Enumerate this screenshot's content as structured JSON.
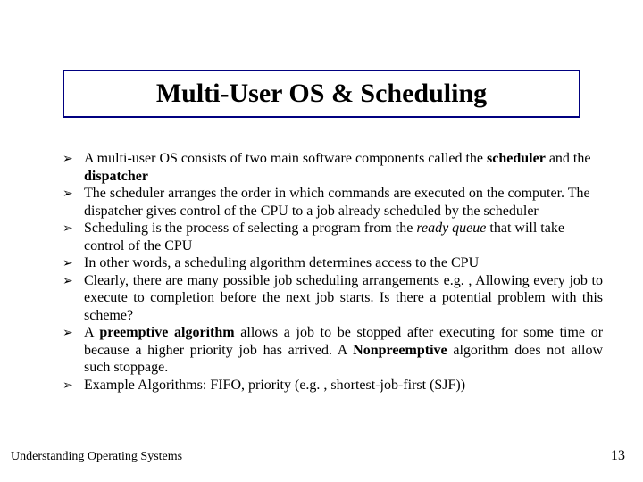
{
  "title": "Multi-User OS & Scheduling",
  "bullets": {
    "b1_pre": "A multi-user OS consists of two main software components called the ",
    "b1_bold1": "scheduler",
    "b1_mid": " and the ",
    "b1_bold2": "dispatcher",
    "b2": "The scheduler arranges the order in which commands are executed on the computer. The dispatcher gives control of the CPU to a job already scheduled by the scheduler",
    "b3_pre": "Scheduling is the process of selecting a program from the ",
    "b3_italic": "ready queue",
    "b3_post": " that will take control of the CPU",
    "b4": "In other words, a scheduling algorithm determines access to the CPU",
    "b5": "Clearly, there are many possible job scheduling arrangements  e.g. , Allowing every job to execute to completion before the next job starts. Is there a potential problem with this scheme?",
    "b6_pre": "A ",
    "b6_bold1": "preemptive algorithm",
    "b6_mid": " allows a job to be stopped after executing for some time or because a higher priority job has arrived. A ",
    "b6_bold2": "Nonpreemptive",
    "b6_post": " algorithm does not allow such stoppage.",
    "b7": "Example Algorithms: FIFO, priority (e.g. , shortest-job-first (SJF))"
  },
  "footer": {
    "left": "Understanding Operating Systems",
    "right": "13"
  },
  "glyphs": {
    "arrow": "➢"
  }
}
